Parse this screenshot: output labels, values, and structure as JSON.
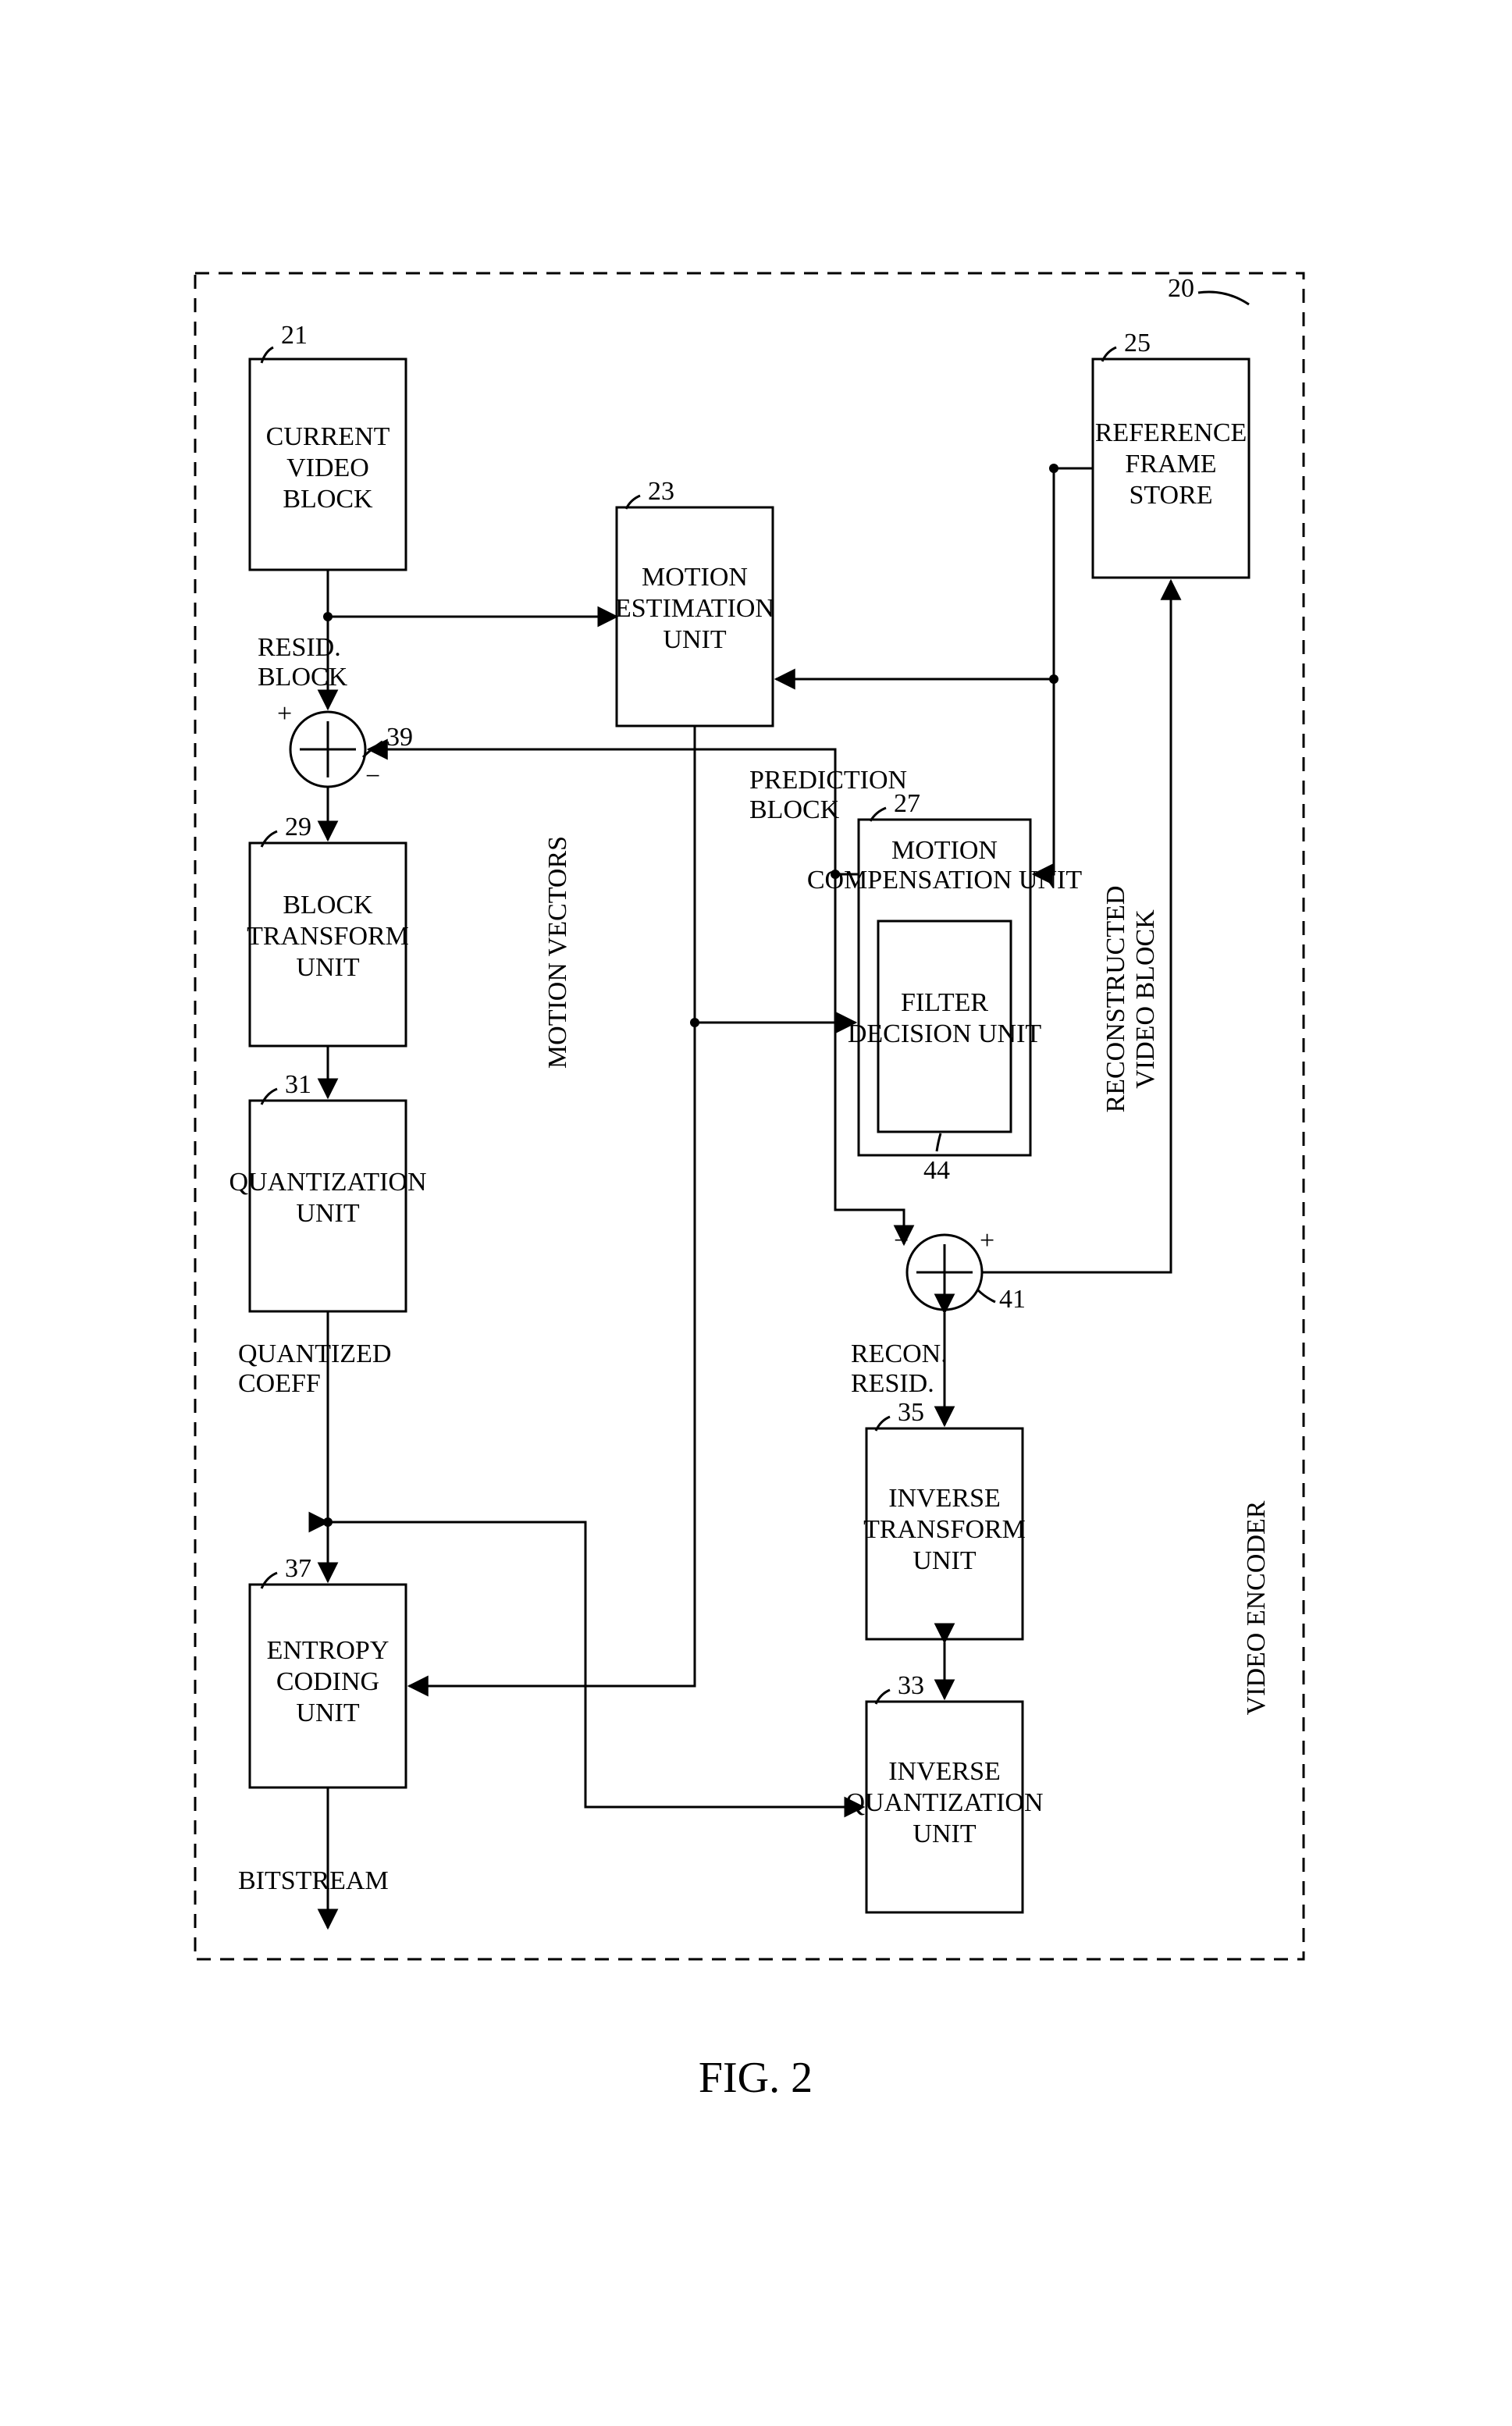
{
  "figure_label": "FIG. 2",
  "container": {
    "title": "VIDEO ENCODER",
    "ref": "20"
  },
  "blocks": {
    "cvb": {
      "line1": "CURRENT",
      "line2": "VIDEO",
      "line3": "BLOCK",
      "ref": "21"
    },
    "meu": {
      "line1": "MOTION",
      "line2": "ESTIMATION",
      "line3": "UNIT",
      "ref": "23"
    },
    "mcu": {
      "line1": "MOTION",
      "line2": "COMPENSATION UNIT",
      "ref": "27"
    },
    "fdu": {
      "line1": "FILTER",
      "line2": "DECISION UNIT",
      "ref": "44"
    },
    "rfs": {
      "line1": "REFERENCE",
      "line2": "FRAME",
      "line3": "STORE",
      "ref": "25"
    },
    "btu": {
      "line1": "BLOCK",
      "line2": "TRANSFORM",
      "line3": "UNIT",
      "ref": "29"
    },
    "qu": {
      "line1": "QUANTIZATION",
      "line2": "UNIT",
      "ref": "31"
    },
    "iqu": {
      "line1": "INVERSE",
      "line2": "QUANTIZATION",
      "line3": "UNIT",
      "ref": "33"
    },
    "itu": {
      "line1": "INVERSE",
      "line2": "TRANSFORM",
      "line3": "UNIT",
      "ref": "35"
    },
    "ecu": {
      "line1": "ENTROPY",
      "line2": "CODING",
      "line3": "UNIT",
      "ref": "37"
    }
  },
  "summers": {
    "s1": {
      "ref": "39"
    },
    "s2": {
      "ref": "41"
    }
  },
  "labels": {
    "resid_block_l1": "RESID.",
    "resid_block_l2": "BLOCK",
    "plus": "+",
    "minus": "−",
    "pred_block_l1": "PREDICTION",
    "pred_block_l2": "BLOCK",
    "motion_vectors": "MOTION VECTORS",
    "quant_coeff_l1": "QUANTIZED",
    "quant_coeff_l2": "COEFF",
    "recon_resid_l1": "RECON.",
    "recon_resid_l2": "RESID.",
    "recon_vb_l1": "RECONSTRUCTED",
    "recon_vb_l2": "VIDEO BLOCK",
    "bitstream": "BITSTREAM"
  }
}
